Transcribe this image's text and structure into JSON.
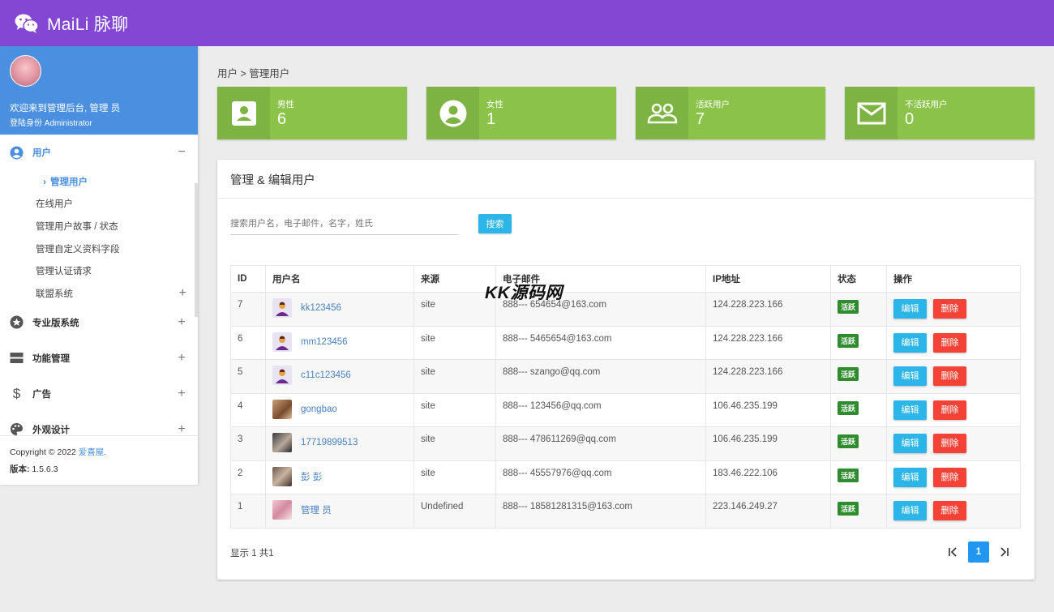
{
  "app": {
    "title": "MaiLi 脉聊"
  },
  "sidebar": {
    "welcome": "欢迎来到管理后台, 管理 员",
    "role": "登陆身份 Administrator",
    "user_menu": {
      "label": "用户",
      "toggle": "−"
    },
    "sub_items": [
      {
        "label": "管理用户"
      },
      {
        "label": "在线用户"
      },
      {
        "label": "管理用户故事 / 状态"
      },
      {
        "label": "管理自定义资料字段"
      },
      {
        "label": "管理认证请求"
      },
      {
        "label": "联盟系统",
        "toggle": "+"
      }
    ],
    "menus": [
      {
        "label": "专业版系统",
        "toggle": "+",
        "icon": "star-icon"
      },
      {
        "label": "功能管理",
        "toggle": "+",
        "icon": "server-icon"
      },
      {
        "label": "广告",
        "toggle": "+",
        "icon": "dollar-icon"
      },
      {
        "label": "外观设计",
        "toggle": "+",
        "icon": "palette-icon"
      }
    ],
    "footer": {
      "copyright": "Copyright © 2022 ",
      "company": "爱喜屋",
      "dot": ".",
      "version_label": "版本: ",
      "version": "1.5.6.3"
    }
  },
  "breadcrumb": "用户 > 管理用户",
  "stats": [
    {
      "label": "男性",
      "value": "6",
      "icon": "male-user-icon"
    },
    {
      "label": "女性",
      "value": "1",
      "icon": "female-user-icon"
    },
    {
      "label": "活跃用户",
      "value": "7",
      "icon": "group-icon"
    },
    {
      "label": "不活跃用户",
      "value": "0",
      "icon": "mail-icon"
    }
  ],
  "panel": {
    "title": "管理 & 编辑用户",
    "search_placeholder": "搜索用户名，电子邮件，名字，姓氏",
    "search_button": "搜索",
    "columns": [
      "ID",
      "用户名",
      "来源",
      "电子邮件",
      "IP地址",
      "状态",
      "操作"
    ],
    "rows": [
      {
        "id": "7",
        "username": "kk123456",
        "source": "site",
        "email": "888--- 654654@163.com",
        "ip": "124.228.223.166",
        "status": "活跃",
        "avatar": "default"
      },
      {
        "id": "6",
        "username": "mm123456",
        "source": "site",
        "email": "888--- 5465654@163.com",
        "ip": "124.228.223.166",
        "status": "活跃",
        "avatar": "default"
      },
      {
        "id": "5",
        "username": "c11c123456",
        "source": "site",
        "email": "888--- szango@qq.com",
        "ip": "124.228.223.166",
        "status": "活跃",
        "avatar": "default"
      },
      {
        "id": "4",
        "username": "gongbao",
        "source": "site",
        "email": "888--- 123456@qq.com",
        "ip": "106.46.235.199",
        "status": "活跃",
        "avatar": "food"
      },
      {
        "id": "3",
        "username": "17719899513",
        "source": "site",
        "email": "888--- 478611269@qq.com",
        "ip": "106.46.235.199",
        "status": "活跃",
        "avatar": "photo-dark"
      },
      {
        "id": "2",
        "username": "彭 彭",
        "source": "site",
        "email": "888--- 45557976@qq.com",
        "ip": "183.46.222.106",
        "status": "活跃",
        "avatar": "photo-brown"
      },
      {
        "id": "1",
        "username": "管理 员",
        "source": "Undefined",
        "email": "888--- 18581281315@163.com",
        "ip": "223.146.249.27",
        "status": "活跃",
        "avatar": "photo-pink"
      }
    ],
    "edit_label": "编辑",
    "delete_label": "删除",
    "showing": "显示 1 共1",
    "pager": {
      "first": "|<",
      "current": "1",
      "last": ">|"
    }
  },
  "watermark": "KK源码网",
  "colors": {
    "header": "#8447d4",
    "profile": "#4a8fe0",
    "stat": "#8bc34a",
    "primary": "#2bb5e8",
    "danger": "#f44336",
    "badge": "#2e8b2e"
  }
}
